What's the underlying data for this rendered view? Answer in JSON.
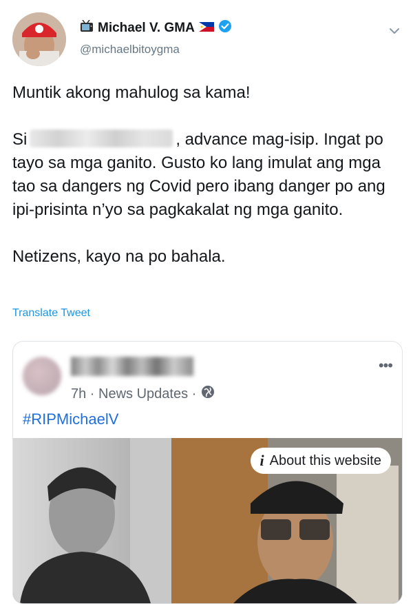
{
  "author": {
    "display_name": "Michael V. GMA",
    "handle": "@michaelbitoygma",
    "icons": [
      "tv-emoji-icon",
      "philippines-flag-icon",
      "verified-badge-icon"
    ]
  },
  "tweet": {
    "line1": "Muntik akong mahulog sa kama!",
    "para2_prefix": "Si",
    "para2_rest": ", advance mag-isip. Ingat po tayo sa mga ganito. Gusto ko lang imulat ang mga tao sa dangers ng Covid pero ibang danger po ang ipi-prisinta n’yo sa pagkakalat ng mga ganito.",
    "line3": "Netizens, kayo na po bahala."
  },
  "translate_label": "Translate Tweet",
  "embedded_post": {
    "meta": "7h · News Updates ·",
    "hashtag": "#RIPMichaelV",
    "about_label": "About this website",
    "more_icon": "more-horizontal-icon"
  },
  "colors": {
    "link": "#1b95e0",
    "hashtag": "#216fdb",
    "verified": "#1da1f2",
    "secondary_text": "#657786"
  }
}
